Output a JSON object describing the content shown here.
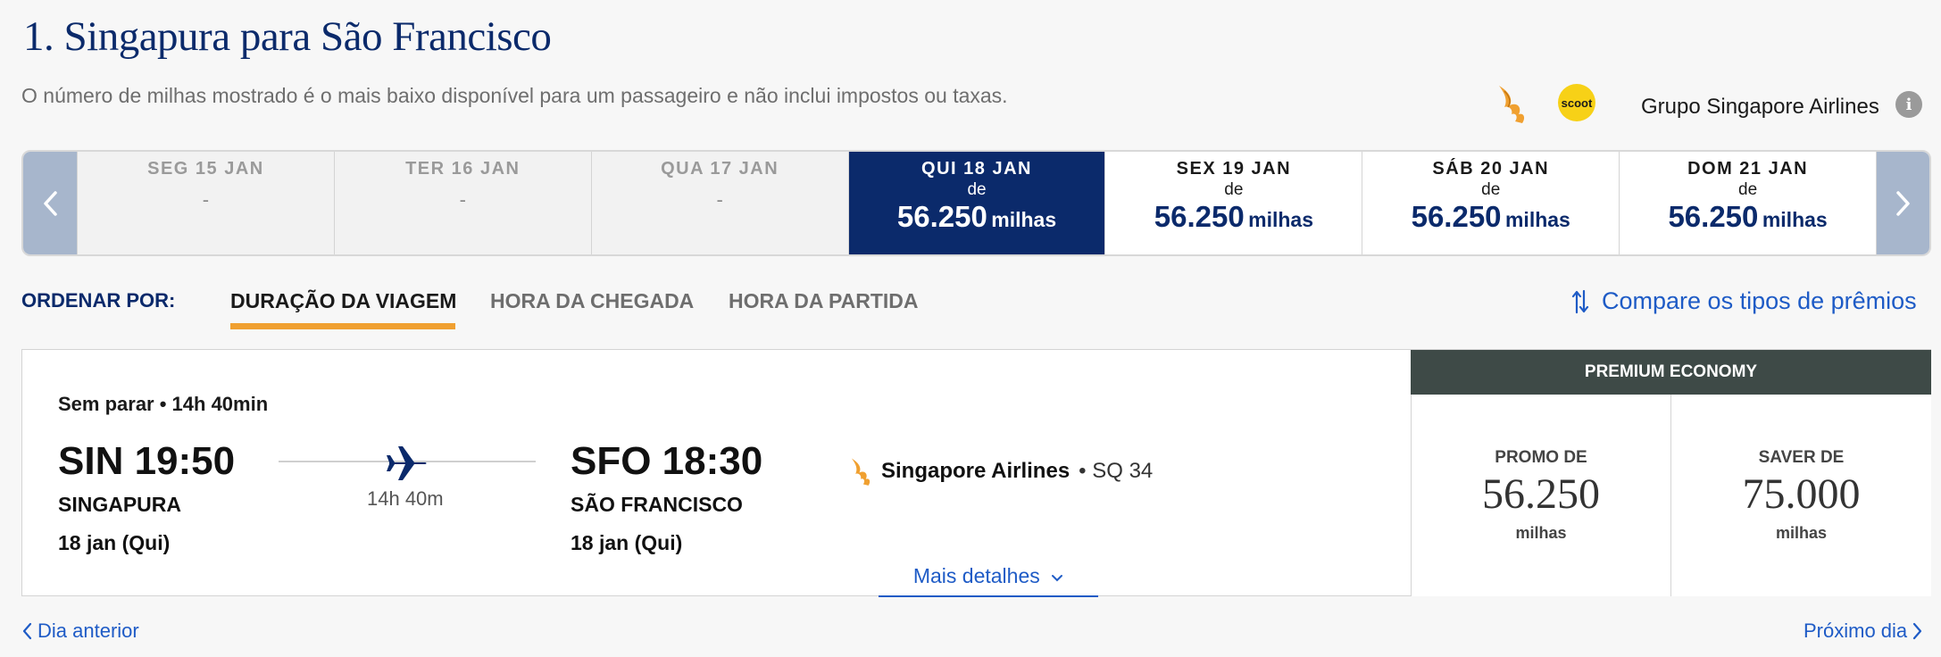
{
  "header": {
    "title": "1. Singapura para São Francisco",
    "subtitle": "O número de milhas mostrado é o mais baixo disponível para um passageiro e não inclui impostos ou taxas.",
    "group_label": "Grupo Singapore Airlines",
    "scoot_label": "scoot",
    "info_glyph": "i"
  },
  "dates": [
    {
      "label": "SEG 15 JAN",
      "value": "-"
    },
    {
      "label": "TER 16 JAN",
      "value": "-"
    },
    {
      "label": "QUA 17 JAN",
      "value": "-"
    },
    {
      "label": "QUI 18 JAN",
      "from": "de",
      "miles": "56.250",
      "unit": "milhas"
    },
    {
      "label": "SEX 19 JAN",
      "from": "de",
      "miles": "56.250",
      "unit": "milhas"
    },
    {
      "label": "SÁB 20 JAN",
      "from": "de",
      "miles": "56.250",
      "unit": "milhas"
    },
    {
      "label": "DOM 21 JAN",
      "from": "de",
      "miles": "56.250",
      "unit": "milhas"
    }
  ],
  "sort": {
    "label": "ORDENAR POR:",
    "options": [
      "DURAÇÃO DA VIAGEM",
      "HORA DA CHEGADA",
      "HORA DA PARTIDA"
    ],
    "compare": "Compare os tipos de prêmios"
  },
  "flight": {
    "stops": "Sem parar • 14h 40min",
    "origin": {
      "code_time": "SIN 19:50",
      "city": "SINGAPURA",
      "date": "18 jan (Qui)"
    },
    "destination": {
      "code_time": "SFO 18:30",
      "city": "SÃO FRANCISCO",
      "date": "18 jan (Qui)"
    },
    "duration": "14h 40m",
    "airline": "Singapore Airlines",
    "flight_no": "• SQ 34",
    "details": "Mais detalhes"
  },
  "fares": {
    "cabin": "PREMIUM ECONOMY",
    "promo": {
      "type": "PROMO DE",
      "amount": "56.250",
      "unit": "milhas"
    },
    "saver": {
      "type": "SAVER DE",
      "amount": "75.000",
      "unit": "milhas"
    }
  },
  "footer": {
    "prev": "Dia anterior",
    "next": "Próximo dia"
  },
  "colors": {
    "brand_navy": "#0b2a6b",
    "link_blue": "#1e5bc6",
    "tab_underline": "#f0a030",
    "cabin_header": "#3e4a47",
    "nav_arrow_bg": "#a7b6cc"
  }
}
